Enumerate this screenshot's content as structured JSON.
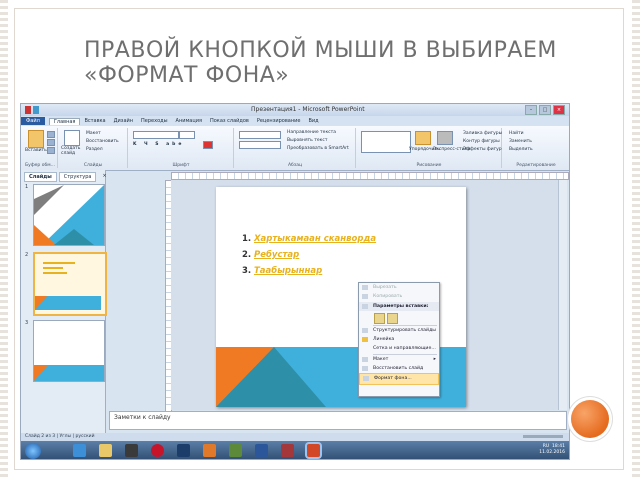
{
  "heading": "ПРАВОЙ КНОПКОЙ МЫШИ В ВЫБИРАЕМ «ФОРМАТ ФОНА»",
  "window": {
    "title": "Презентация1 - Microsoft PowerPoint"
  },
  "tabs": [
    "Файл",
    "Главная",
    "Вставка",
    "Дизайн",
    "Переходы",
    "Анимация",
    "Показ слайдов",
    "Рецензирование",
    "Вид"
  ],
  "ribbon": {
    "groups": [
      "Буфер обм...",
      "Слайды",
      "Шрифт",
      "Абзац",
      "Рисование",
      "Редактирование"
    ],
    "clipboard": {
      "paste": "Вставить"
    },
    "slides": {
      "new_slide": "Создать слайд",
      "layout": "Макет",
      "reset": "Восстановить",
      "section": "Раздел"
    },
    "paragraph": {
      "text_direction": "Направление текста",
      "align_text": "Выровнять текст",
      "smartart": "Преобразовать в SmartArt"
    },
    "drawing": {
      "arrange": "Упорядочить",
      "quick_styles": "Экспресс-стили"
    },
    "shape_tools": {
      "fill": "Заливка фигуры",
      "outline": "Контур фигуры",
      "effects": "Эффекты фигур"
    },
    "editing": {
      "find": "Найти",
      "replace": "Заменить",
      "select": "Выделить"
    }
  },
  "left_pane": {
    "tabs": [
      "Слайды",
      "Структура"
    ],
    "slide_numbers": [
      "1",
      "2",
      "3"
    ]
  },
  "slide": {
    "list": [
      {
        "n": "1.",
        "text": "Хартыкамаан сканворда"
      },
      {
        "n": "2.",
        "text": "Ребустар"
      },
      {
        "n": "3.",
        "text": "Таабырыннар"
      }
    ]
  },
  "context_menu": {
    "items": [
      {
        "label": "Вырезать",
        "disabled": true
      },
      {
        "label": "Копировать",
        "disabled": true
      },
      {
        "label": "Параметры вставки:",
        "header": true
      },
      {
        "label": "Структурировать слайды"
      },
      {
        "label": "Линейка"
      },
      {
        "label": "Сетка и направляющие..."
      },
      {
        "label": "Макет",
        "submenu": true
      },
      {
        "label": "Восстановить слайд"
      },
      {
        "label": "Формат фона...",
        "highlighted": true
      }
    ]
  },
  "notes": {
    "placeholder": "Заметки к слайду"
  },
  "status": {
    "left": "Слайд 2 из 3",
    "theme": "Углы",
    "lang": "русский"
  },
  "tray": {
    "lang": "RU",
    "time": "18:41",
    "date": "11.02.2016"
  },
  "colors": {
    "accent_blue": "#3fb0dc",
    "accent_orange": "#f07a23",
    "teal": "#2e8fa8"
  }
}
